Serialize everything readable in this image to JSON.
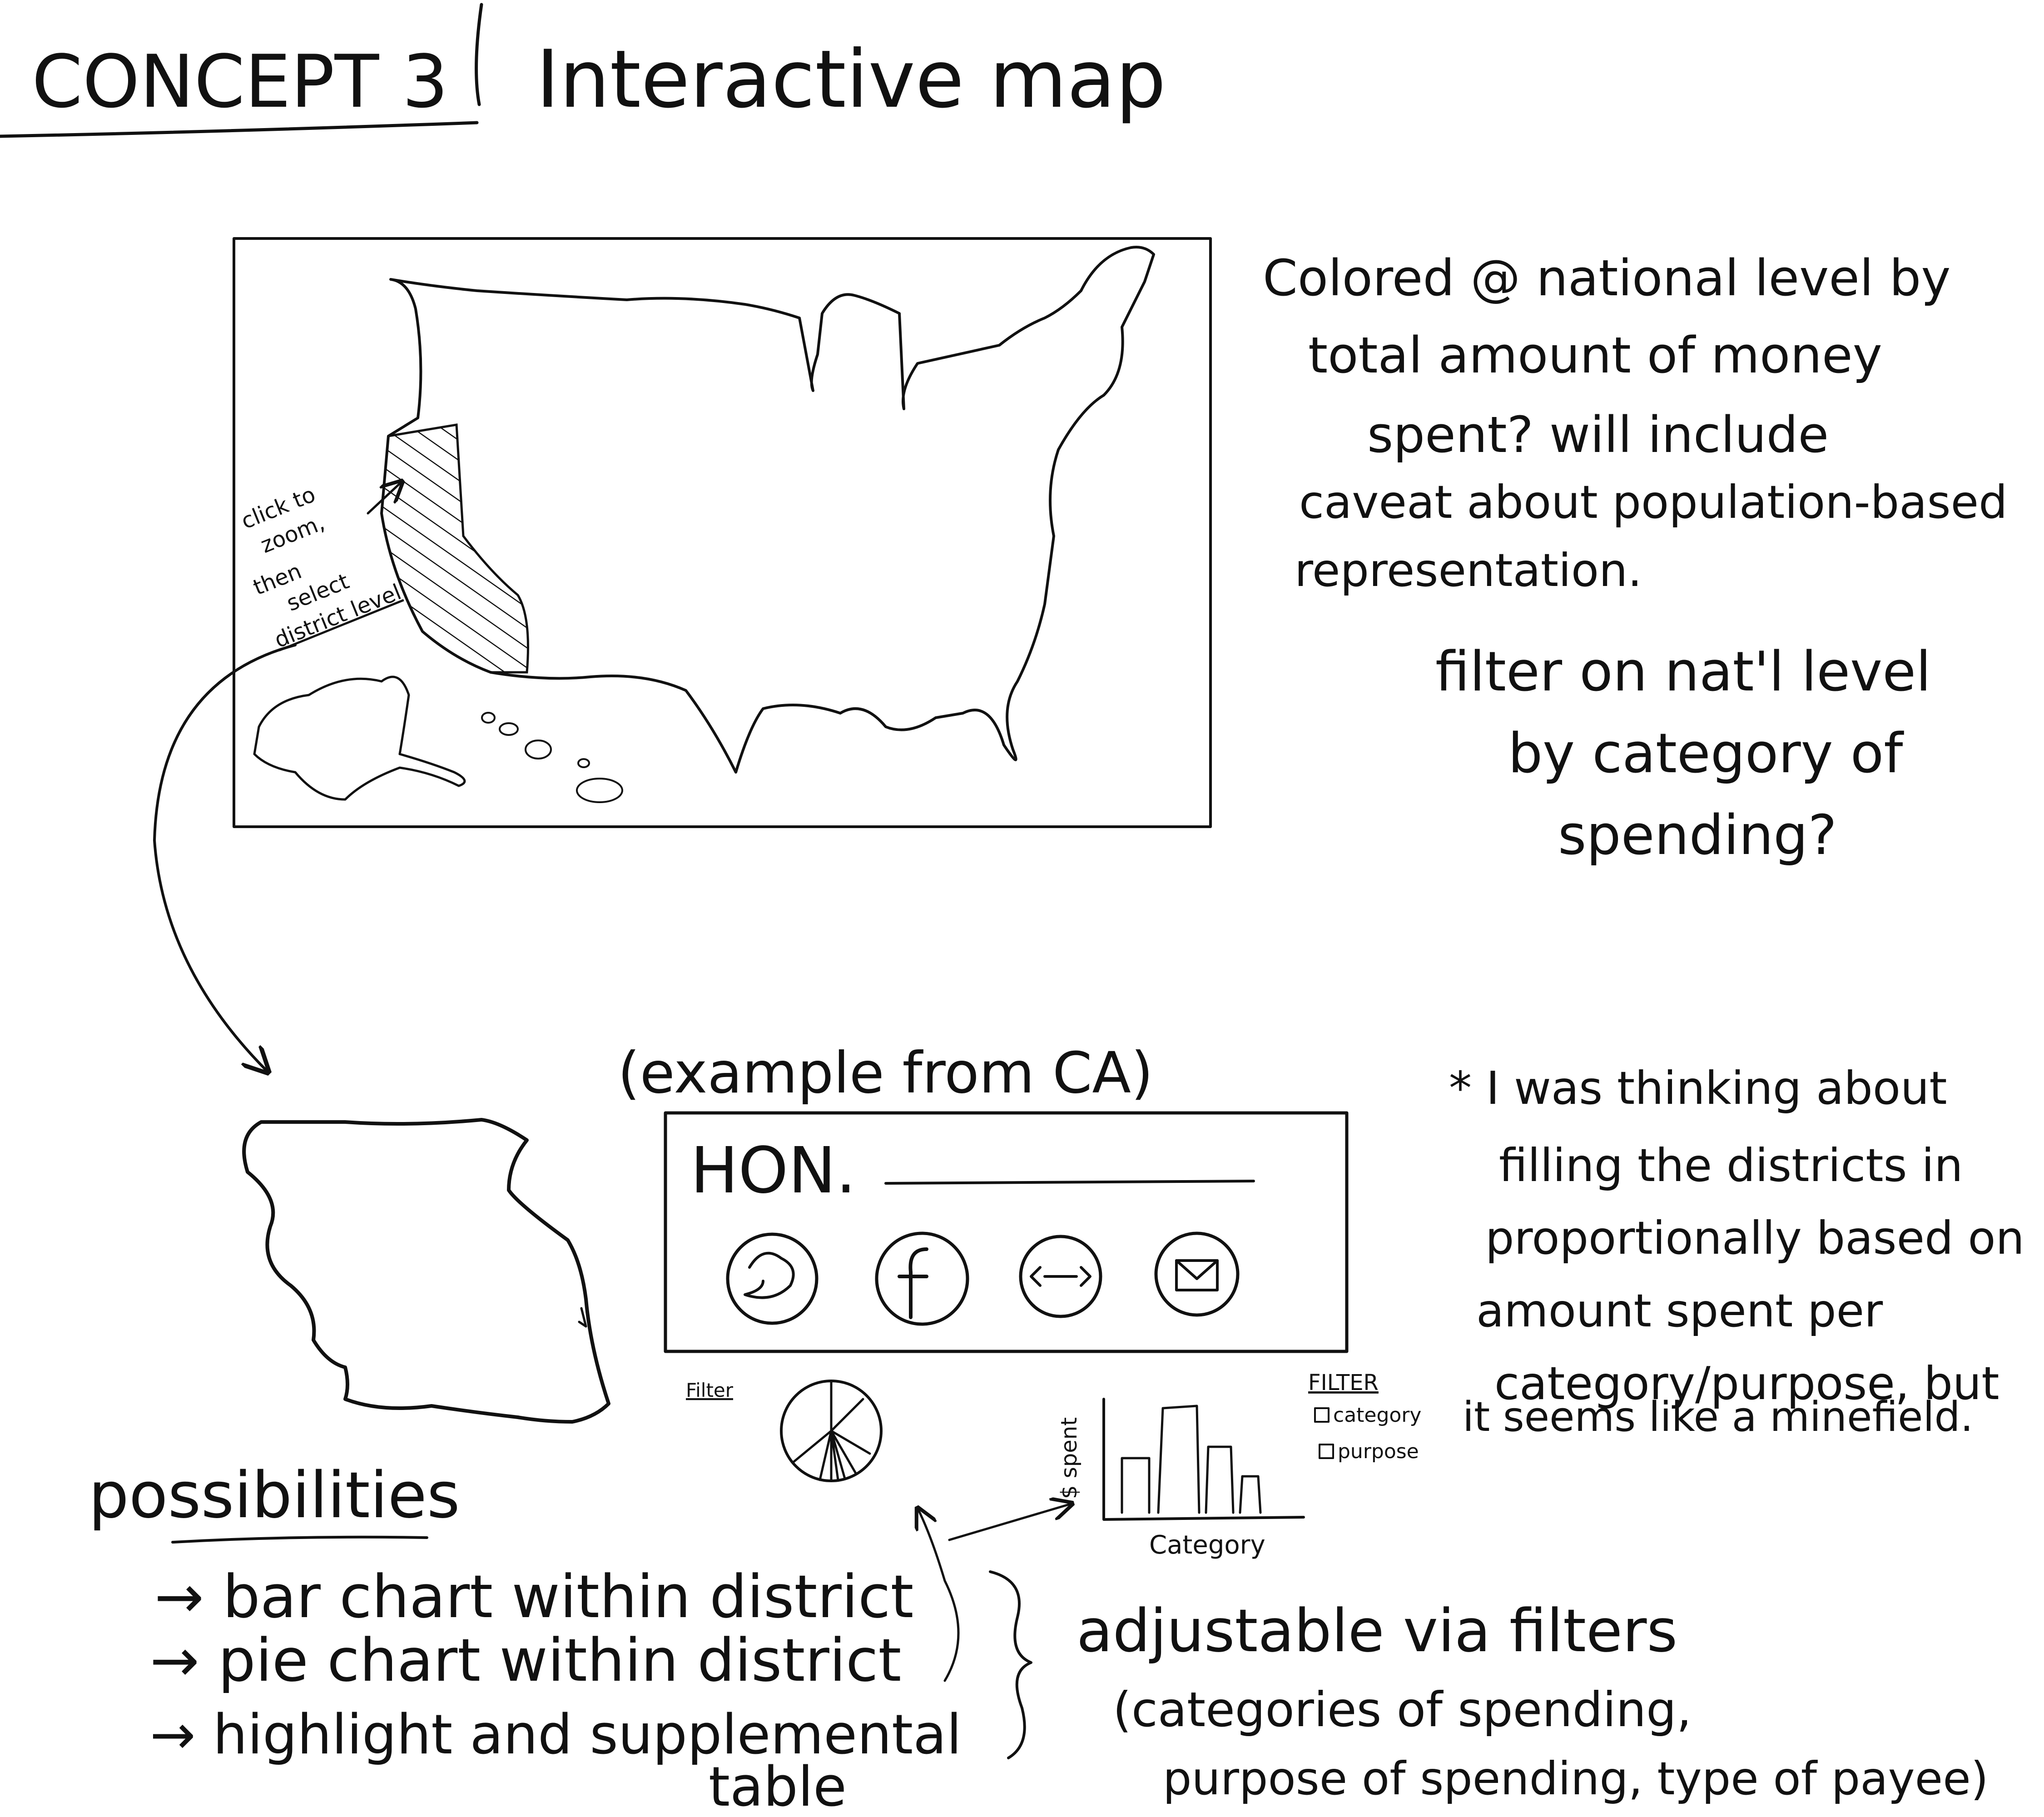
{
  "header": {
    "concept": "CONCEPT 3",
    "title": "Interactive map"
  },
  "map_annotation": {
    "lines": [
      "click to",
      "zoom,",
      "then",
      "select",
      "district level"
    ]
  },
  "right_notes": {
    "lines": [
      "Colored @ national level by",
      "total amount of money",
      "spent? will include",
      "caveat about population-based",
      "representation."
    ],
    "filter_lines": [
      "filter on nat'l level",
      "by category of",
      "spending?"
    ]
  },
  "example_label": "(example from CA)",
  "card": {
    "title": "HON.",
    "icons": [
      "twitter-bird-icon",
      "facebook-icon",
      "link-icon",
      "mail-icon"
    ]
  },
  "star_note": {
    "lines": [
      "* I was thinking about",
      "filling the districts in",
      "proportionally based on",
      "amount spent per",
      "category/purpose, but",
      "it seems like a minefield."
    ]
  },
  "pie_filter_label": "Filter",
  "bar_chart": {
    "ylabel": "$ spent",
    "xlabel": "Category"
  },
  "filter_panel": {
    "title": "FILTER",
    "options": [
      "category",
      "purpose"
    ]
  },
  "possibilities": {
    "heading": "possibilities",
    "items": [
      "→ bar chart within district",
      "→ pie chart within district",
      "→ highlight and supplemental"
    ],
    "last_line_cont": "table"
  },
  "adjustable": {
    "lines": [
      "adjustable via filters",
      "(categories of spending,",
      "purpose of spending, type of payee)"
    ]
  }
}
